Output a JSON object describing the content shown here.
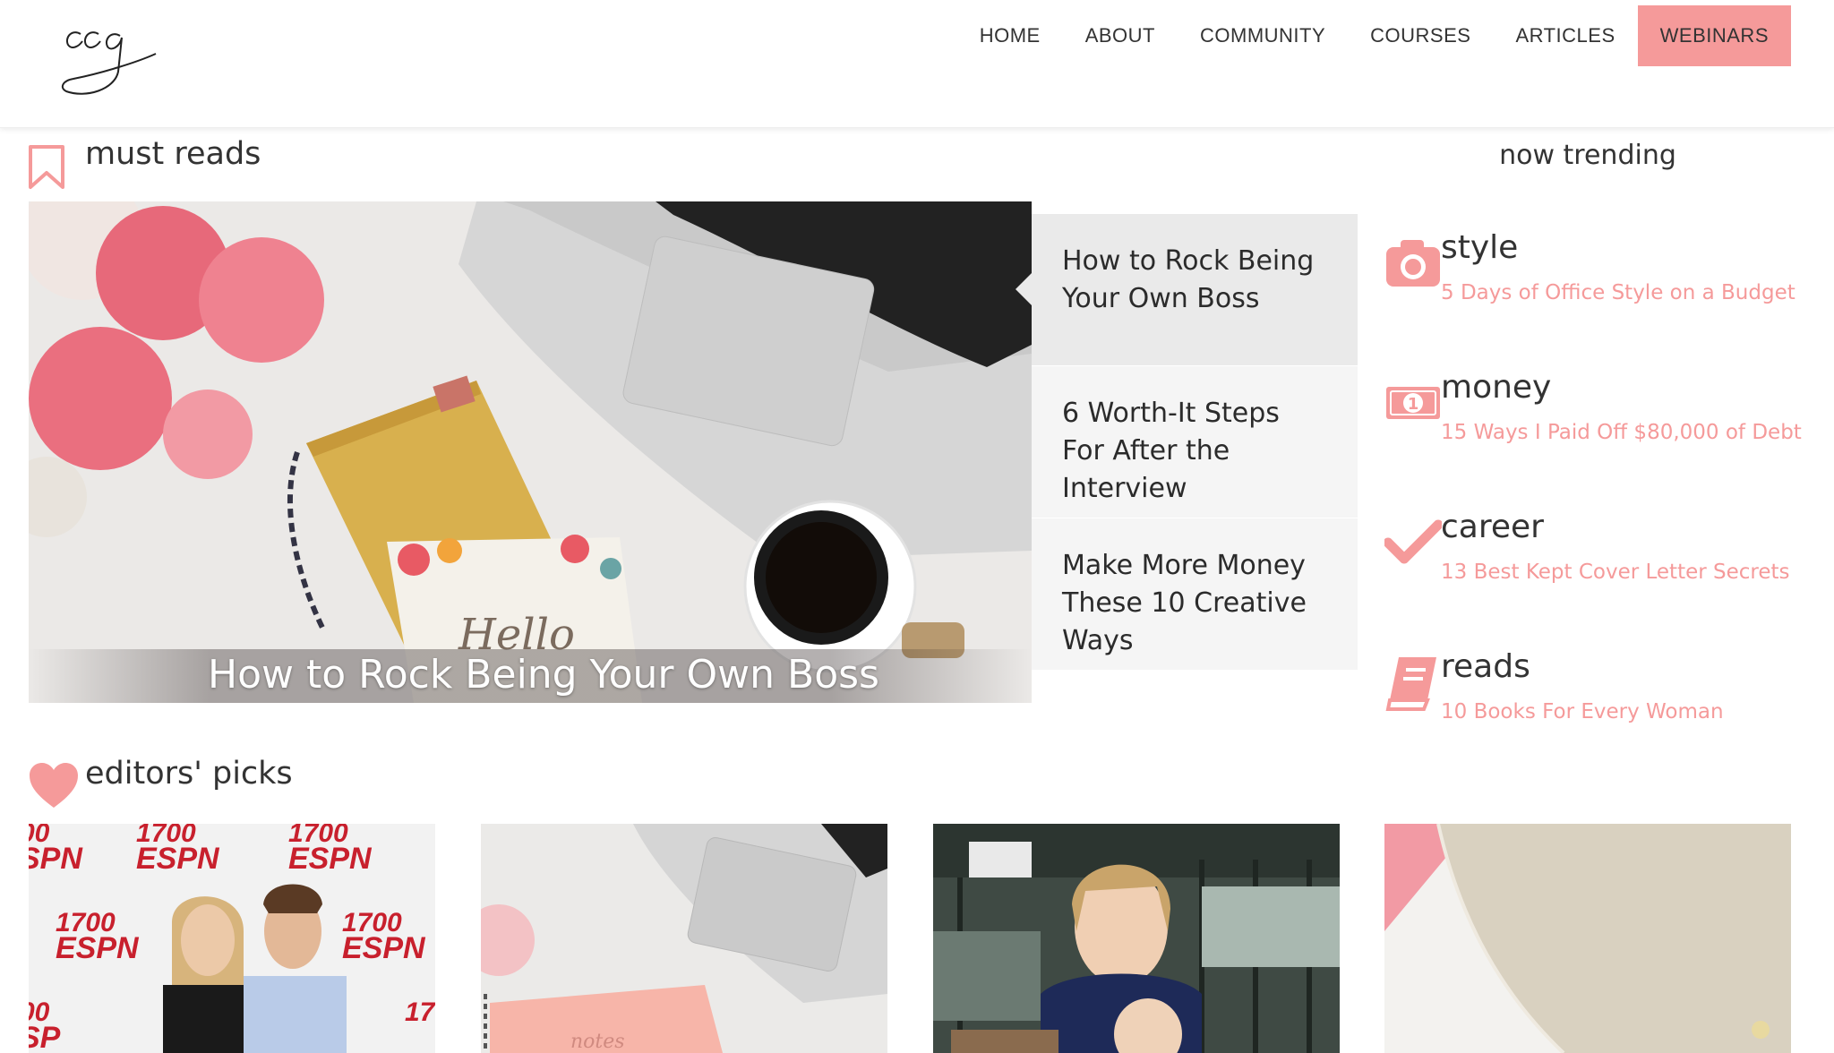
{
  "site": {
    "logo_text": "ccg"
  },
  "nav": {
    "items": [
      {
        "label": "HOME"
      },
      {
        "label": "ABOUT"
      },
      {
        "label": "COMMUNITY"
      },
      {
        "label": "COURSES"
      },
      {
        "label": "ARTICLES"
      },
      {
        "label": "WEBINARS",
        "active": true
      }
    ]
  },
  "must_reads": {
    "title": "must reads",
    "hero_caption": "How to Rock Being Your Own Boss",
    "articles": [
      {
        "title": "How to Rock Being Your Own Boss",
        "active": true
      },
      {
        "title": "6 Worth-It Steps For After the Interview"
      },
      {
        "title": "Make More Money These 10 Creative Ways"
      }
    ]
  },
  "trending": {
    "heading": "now trending",
    "items": [
      {
        "icon": "camera-icon",
        "category": "style",
        "link": "5 Days of Office Style on a Budget"
      },
      {
        "icon": "money-bill-icon",
        "category": "money",
        "link": "15 Ways I Paid Off $80,000 of Debt"
      },
      {
        "icon": "checkmark-icon",
        "category": "career",
        "link": "13 Best Kept Cover Letter Secrets"
      },
      {
        "icon": "book-icon",
        "category": "reads",
        "link": "10 Books For Every Woman"
      }
    ]
  },
  "editors_picks": {
    "title": "editors' picks",
    "items": [
      {
        "alt": "Couple at 1700 ESPN press wall"
      },
      {
        "alt": "Laptop and pink notebook"
      },
      {
        "alt": "Smiling woman with child on bus"
      },
      {
        "alt": "Gold pouch on marble"
      }
    ]
  },
  "colors": {
    "accent": "#f59a9a",
    "list_bg": "#f5f5f5",
    "list_active_bg": "#eaeaea",
    "text": "#333333"
  }
}
